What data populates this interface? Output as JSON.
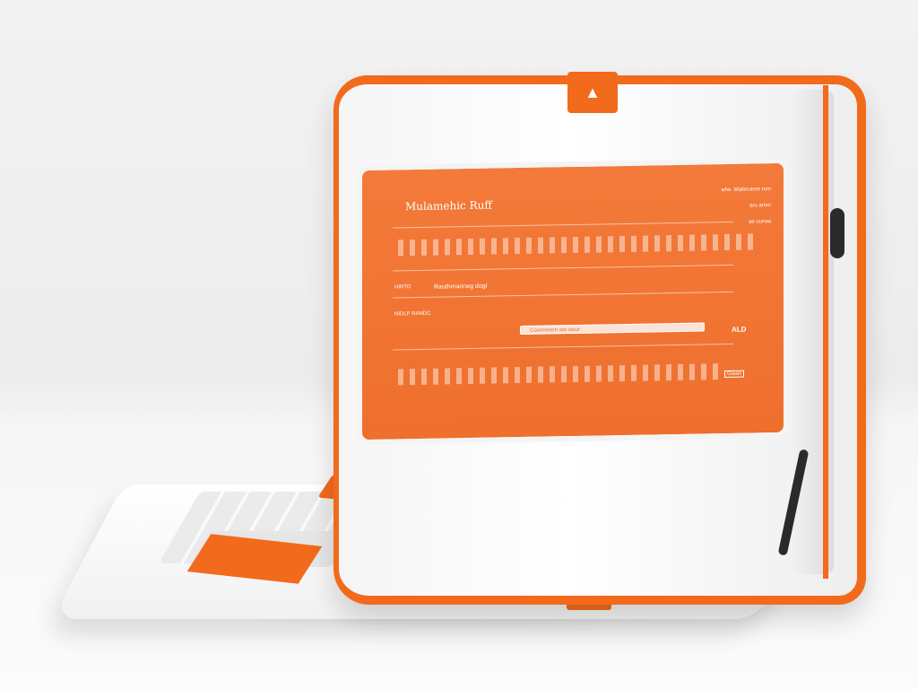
{
  "screen": {
    "title": "Mulamehic Ruff",
    "top_right_line1": "whe. Mallecaree rom",
    "top_right_line2": "aru arnm",
    "top_right_line3": "aa uunaa",
    "field1_label": "HIRTO",
    "field1_value": "Rauthmanneg dogl",
    "field2_label": "NIDLP RANDC",
    "search_text": "Commmem ww weur",
    "count": "ALD",
    "button_label": "Giaan"
  },
  "colors": {
    "case_accent": "#f26a1b",
    "screen_bg": "#ef6f2d",
    "case_body": "#f5f5f5"
  },
  "icons": {
    "top_tab": "logo-tab-icon",
    "zipper": "zipper-pull-icon"
  }
}
